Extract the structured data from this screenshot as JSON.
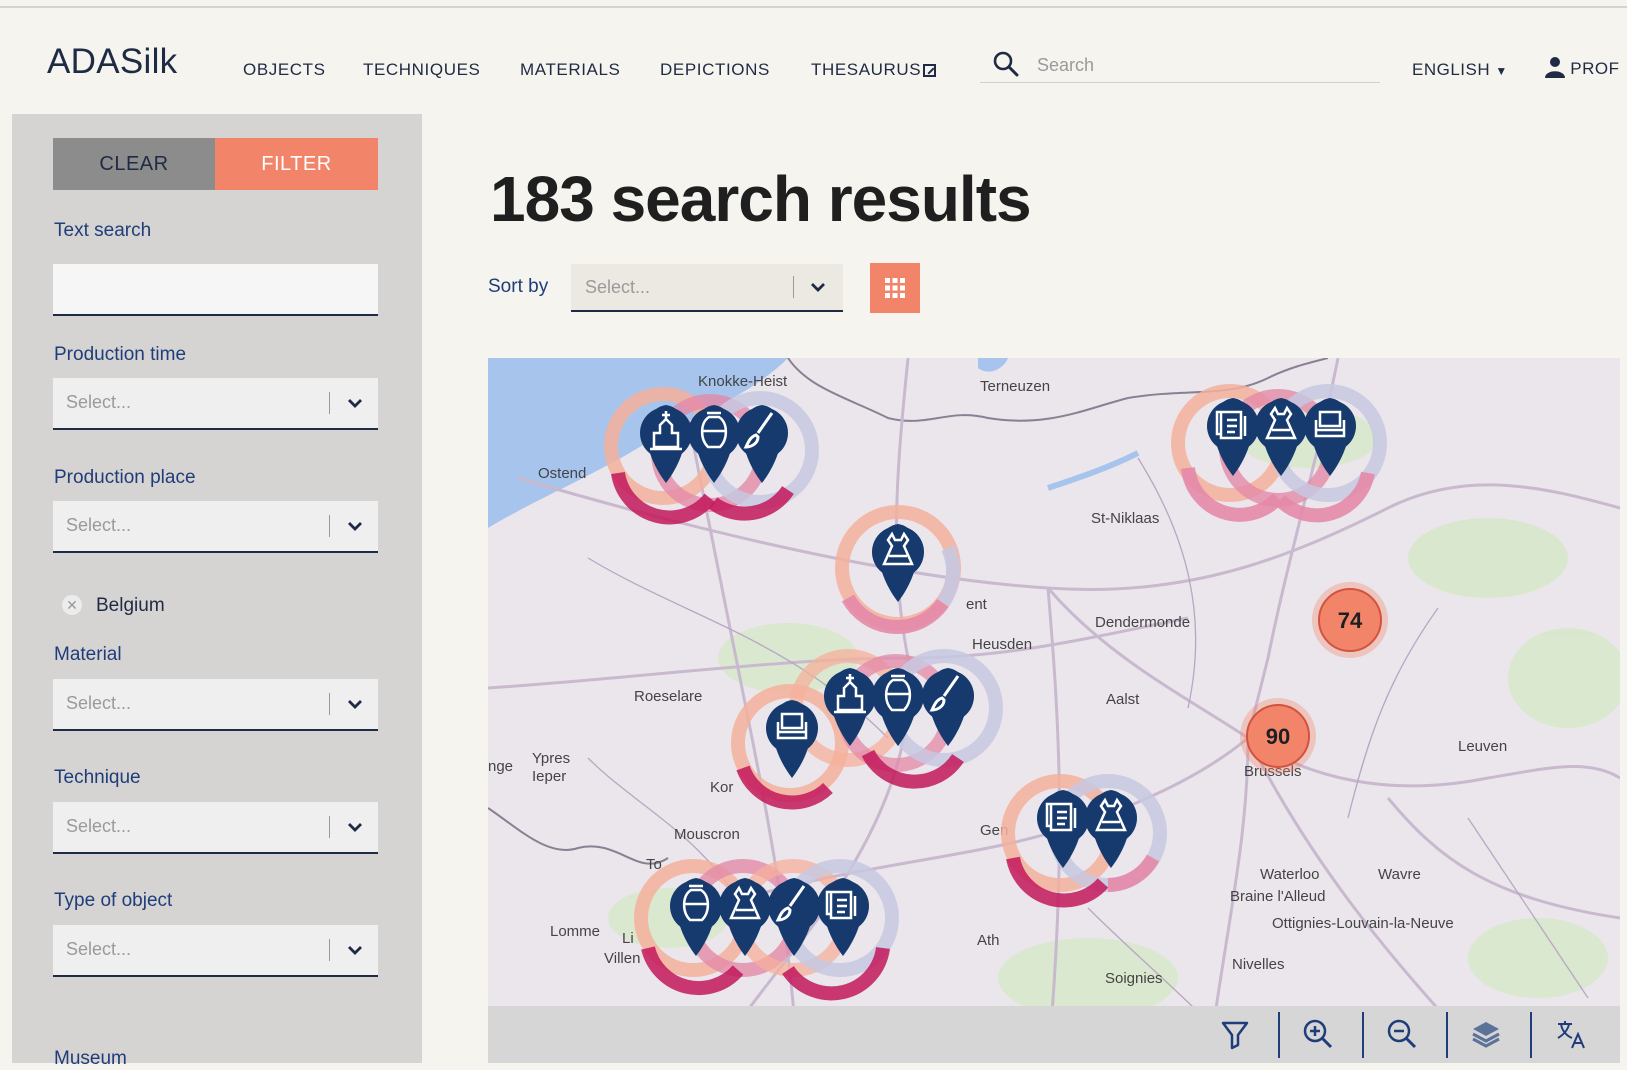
{
  "header": {
    "logo": "ADASilk",
    "nav": [
      "OBJECTS",
      "TECHNIQUES",
      "MATERIALS",
      "DEPICTIONS",
      "THESAURUS"
    ],
    "search_placeholder": "Search",
    "language": "ENGLISH",
    "profile": "PROF"
  },
  "sidebar": {
    "clear_label": "CLEAR",
    "filter_label": "FILTER",
    "text_search_label": "Text search",
    "select_placeholder": "Select...",
    "production_time_label": "Production time",
    "production_place_label": "Production place",
    "selected_place": "Belgium",
    "material_label": "Material",
    "technique_label": "Technique",
    "type_of_object_label": "Type of object",
    "museum_label": "Museum"
  },
  "main": {
    "results_title": "183 search results",
    "sort_label": "Sort by",
    "sort_placeholder": "Select..."
  },
  "map": {
    "places": [
      "Knokke-Heist",
      "Terneuzen",
      "Ostend",
      "St-Niklaas",
      "Dendermonde",
      "Heusden",
      "Roeselare",
      "Aalst",
      "Ypres",
      "Ieper",
      "Kor",
      "Mouscron",
      "Brussels",
      "Leuven",
      "Waterloo",
      "Wavre",
      "Braine l'Alleud",
      "Ottignies-Louvain-la-Neuve",
      "Nivelles",
      "Lomme",
      "Ath",
      "Soignies",
      "Gen",
      "ent",
      "nge",
      "Villen",
      "Li",
      "To"
    ],
    "clusters": [
      74,
      90
    ],
    "colors": {
      "marker": "#163a6e",
      "ring_pink": "#e48aa8",
      "ring_magenta": "#c2185b",
      "ring_peach": "#f5b09c",
      "ring_lilac": "#c7c8e0",
      "cluster": "#f2846a"
    }
  }
}
